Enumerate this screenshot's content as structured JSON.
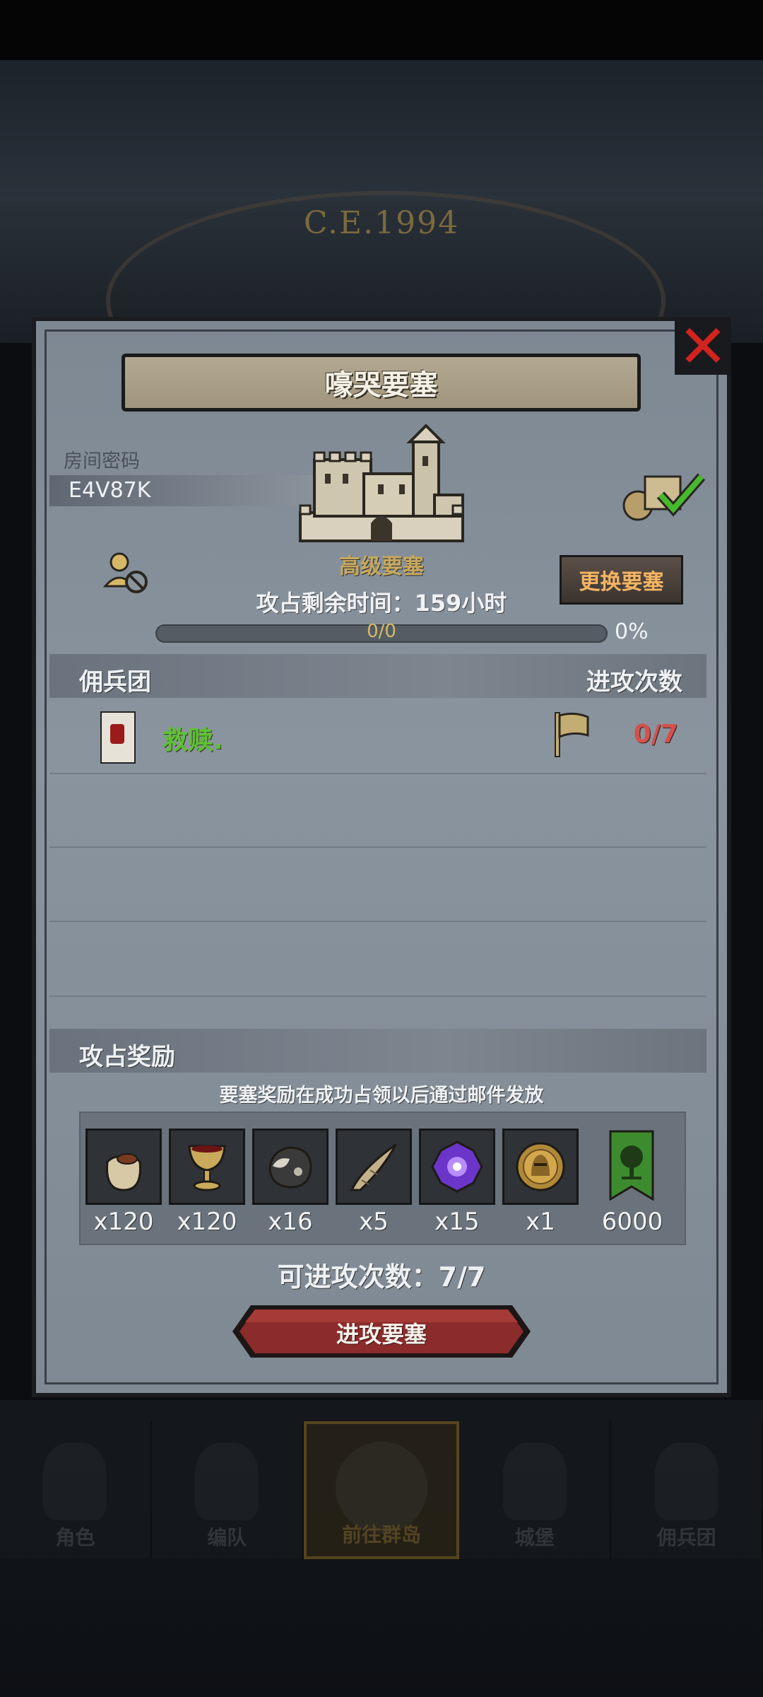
{
  "background": {
    "era_label": "C.E.1994"
  },
  "dialog": {
    "title": "嚎哭要塞",
    "room_label": "房间密码",
    "room_code": "E4V87K",
    "fortress_level": "高级要塞",
    "remaining_time_label": "攻占剩余时间：",
    "remaining_time_value": "159",
    "remaining_time_unit": "小时",
    "progress_text": "0/0",
    "progress_percent": "0%",
    "progress_value": 0,
    "change_button": "更换要塞",
    "close_icon": "close-x-icon"
  },
  "mercenary_section": {
    "header_left": "佣兵团",
    "header_right": "进攻次数",
    "rows": [
      {
        "name": "救赎.",
        "attacks": "0/7"
      }
    ]
  },
  "reward_section": {
    "header": "攻占奖励",
    "note": "要塞奖励在成功占领以后通过邮件发放",
    "items": [
      {
        "icon": "grain-sack-icon",
        "qty": "x120"
      },
      {
        "icon": "goblet-icon",
        "qty": "x120"
      },
      {
        "icon": "ore-stone-icon",
        "qty": "x16"
      },
      {
        "icon": "horn-icon",
        "qty": "x5"
      },
      {
        "icon": "purple-crystal-icon",
        "qty": "x15"
      },
      {
        "icon": "knight-medal-icon",
        "qty": "x1"
      },
      {
        "icon": "guild-tree-banner-icon",
        "qty": "6000"
      }
    ],
    "attack_count_label": "可进攻次数：",
    "attack_count_value": "7/7",
    "attack_button": "进攻要塞"
  },
  "bottom_nav": [
    {
      "label": "角色",
      "icon": "armor-icon"
    },
    {
      "label": "编队",
      "icon": "helmet-icon"
    },
    {
      "label": "前往群岛",
      "icon": "globe-icon",
      "active": true
    },
    {
      "label": "城堡",
      "icon": "castle-icon"
    },
    {
      "label": "佣兵团",
      "icon": "mercenary-icon"
    }
  ],
  "colors": {
    "close": "#d2231e",
    "mercenary_name": "#5fc134",
    "attack_count": "#d4504a",
    "change_button_text": "#f4b462",
    "fortress_level": "#c7a85e",
    "attack_button": "#8c2b2b"
  }
}
